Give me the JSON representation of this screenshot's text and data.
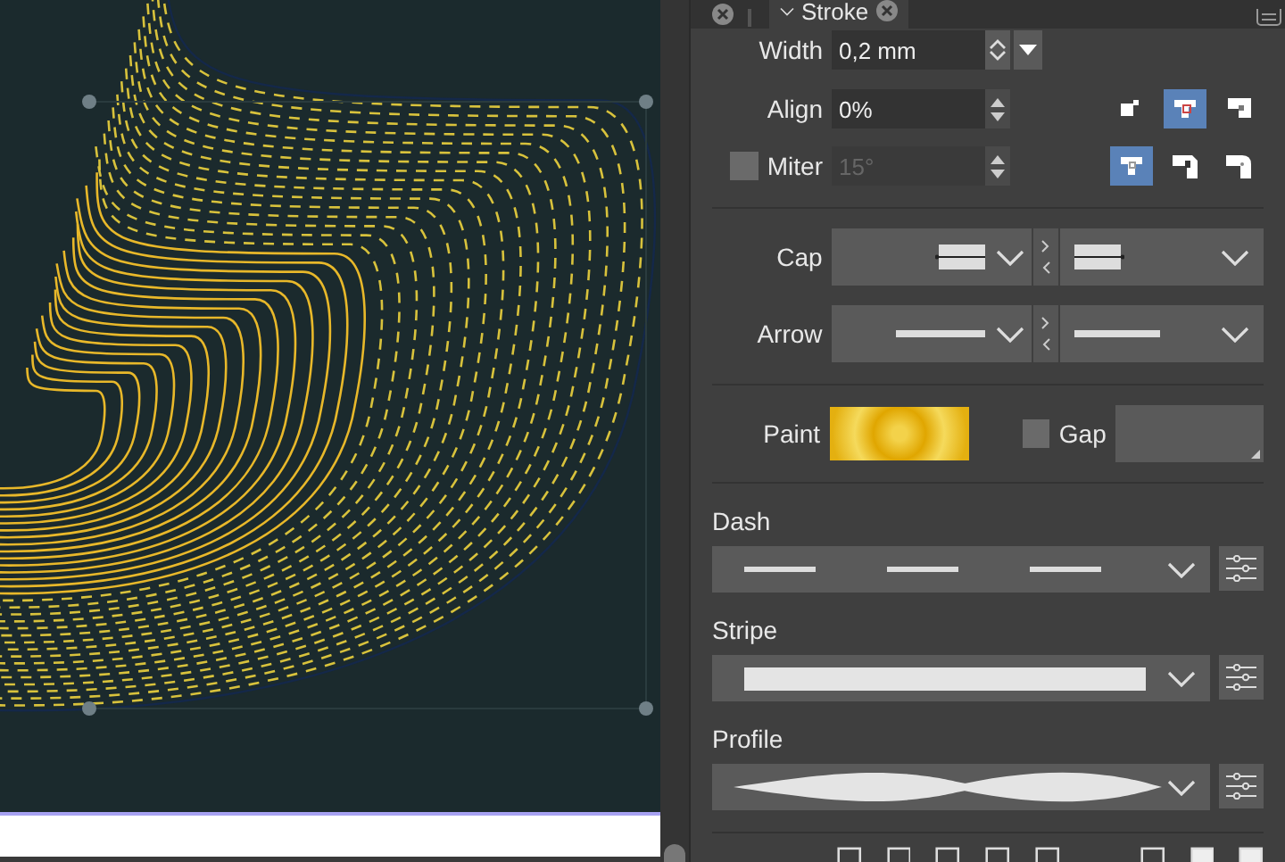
{
  "tabs": [
    {
      "label": "Stroke",
      "selected": true
    }
  ],
  "width": {
    "label": "Width",
    "value": "0,2 mm"
  },
  "align": {
    "label": "Align",
    "value": "0%",
    "options": [
      {
        "selected": false
      },
      {
        "selected": true
      },
      {
        "selected": false
      }
    ]
  },
  "miter": {
    "label": "Miter",
    "checked": false,
    "value": "15°",
    "disabled": true,
    "joins": [
      {
        "selected": true
      },
      {
        "selected": false
      },
      {
        "selected": false
      }
    ]
  },
  "cap": {
    "label": "Cap"
  },
  "arrow": {
    "label": "Arrow"
  },
  "paint": {
    "label": "Paint"
  },
  "gap": {
    "label": "Gap",
    "checked": false
  },
  "dash": {
    "label": "Dash"
  },
  "stripe": {
    "label": "Stripe"
  },
  "profile": {
    "label": "Profile"
  }
}
